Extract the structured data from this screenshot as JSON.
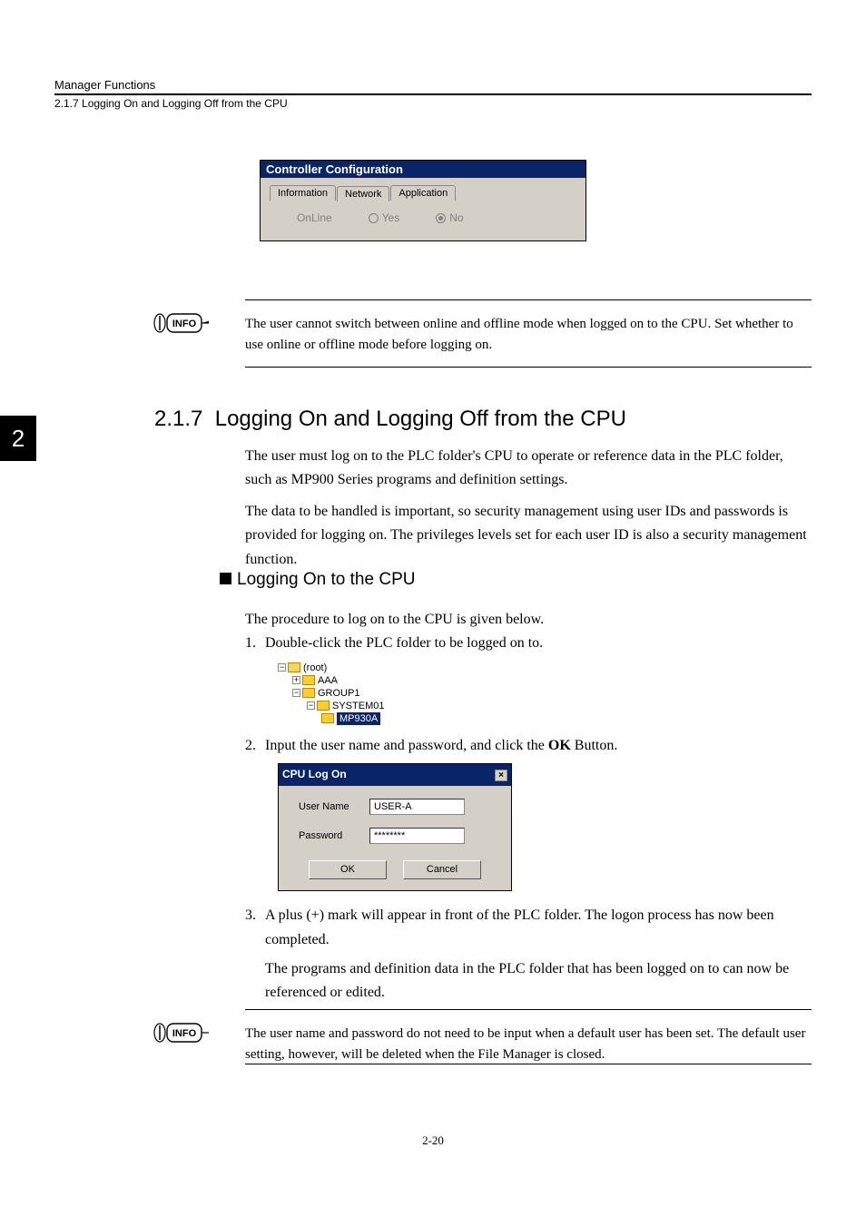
{
  "header": {
    "category": "Manager Functions",
    "breadcrumb": "2.1.7  Logging On and Logging Off from the CPU"
  },
  "cc_dialog": {
    "title": "Controller Configuration",
    "tabs": [
      "Information",
      "Network",
      "Application"
    ],
    "online_label": "OnLine",
    "yes_label": "Yes",
    "no_label": "No"
  },
  "info1": {
    "text": "The user cannot switch between online and offline mode when logged on to the CPU. Set whether to use online or offline mode before logging on."
  },
  "section": {
    "number": "2.1.7",
    "title": "Logging On and Logging Off from the CPU"
  },
  "chapter_tab": "2",
  "body": {
    "p1": "The user must log on to the PLC folder's CPU to operate or reference data in the PLC folder, such as MP900 Series programs and definition settings.",
    "p2": "The data to be handled is important, so security management using user IDs and passwords is provided for logging on. The privileges levels set for each user ID is also a security management function."
  },
  "sub_heading": "Logging On to the CPU",
  "procedure_intro": "The procedure to log on to the CPU is given below.",
  "steps": {
    "s1": "Double-click the PLC folder to be logged on to.",
    "s2_pre": "Input the user name and password, and click the ",
    "s2_ok": "OK",
    "s2_post": " Button.",
    "s3_p1": "A plus (+) mark will appear in front of the PLC folder. The logon process has now been completed.",
    "s3_p2": "The programs and definition data in the PLC folder that has been logged on to can now be referenced or edited."
  },
  "tree": {
    "root": "(root)",
    "n1": "AAA",
    "n2": "GROUP1",
    "n3": "SYSTEM01",
    "n4": "MP930A"
  },
  "logon": {
    "title": "CPU Log On",
    "user_label": "User Name",
    "user_value": "USER-A",
    "pass_label": "Password",
    "pass_value": "********",
    "ok": "OK",
    "cancel": "Cancel"
  },
  "info2": {
    "text": "The user name and password do not need to be input when a default user has been set. The default user setting, however, will be deleted when the File Manager is closed."
  },
  "page_number": "2-20",
  "info_badge_label": "INFO"
}
